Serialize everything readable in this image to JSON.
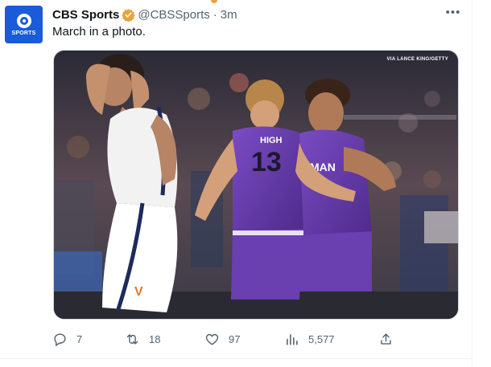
{
  "tweet": {
    "author_name": "CBS Sports",
    "handle": "@CBSSports",
    "separator": "·",
    "time": "3m",
    "text": "March in a photo.",
    "avatar_label": "SPORTS",
    "photo_credit": "VIA LANCE KING/GETTY",
    "jersey_left_name": "HIGH",
    "jersey_left_number": "13",
    "jersey_right_name": "MAN",
    "shorts_logo": "V"
  },
  "actions": {
    "replies": "7",
    "reposts": "18",
    "likes": "97",
    "views": "5,577"
  },
  "colors": {
    "avatar_bg": "#1a5bd8",
    "verified_badge": "#e8a33a",
    "text_secondary": "#536471",
    "jersey_purple": "#6a3fb0"
  },
  "icons": {
    "reply": "reply-icon",
    "repost": "repost-icon",
    "like": "heart-icon",
    "views": "views-icon",
    "share": "share-icon",
    "more": "more-icon",
    "verified": "verified-badge-icon"
  }
}
